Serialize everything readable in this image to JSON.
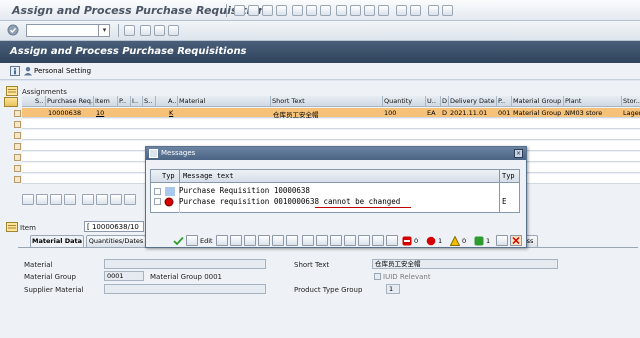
{
  "window": {
    "title": "Assign and Process Purchase Requisitions"
  },
  "toolbar": {
    "command_value": ""
  },
  "header": {
    "title": "Assign and Process Purchase Requisitions"
  },
  "app_toolbar": {
    "personal_setting": "Personal Setting"
  },
  "assignments": {
    "label": "Assignments",
    "columns": [
      "S..",
      "Purchase Req.",
      "Item",
      "P..",
      "I..",
      "S..",
      "A..",
      "Material",
      "Short Text",
      "Quantity",
      "U..",
      "D",
      "Delivery Date",
      "P..",
      "Material Group",
      "Plant",
      "Stor.."
    ],
    "row": {
      "purchase_req": "10000638",
      "item": "10",
      "acct": "K",
      "short_text": "仓库员工安全帽",
      "quantity": "100",
      "unit": "EA",
      "d": "D",
      "delivery_date": "2021.11.01",
      "p": "001",
      "material_group": "Material Group ...",
      "plant": "NM03 store",
      "stor": "Lager"
    }
  },
  "item_bar": {
    "label": "Item",
    "value": "[ 10000638/10"
  },
  "tabs": [
    "Material Data",
    "Quantities/Dates",
    "ss"
  ],
  "material_form": {
    "material_label": "Material",
    "material_group_label": "Material Group",
    "material_group_value": "0001",
    "material_group_desc": "Material Group 0001",
    "supplier_material_label": "Supplier Material",
    "short_text_label": "Short Text",
    "short_text_value": "仓库员工安全帽",
    "iuid_label": "IUID Relevant",
    "product_type_label": "Product Type Group",
    "product_type_value": "1"
  },
  "popup": {
    "title": "Messages",
    "col_typ": "Typ",
    "col_message": "Message text",
    "col_typ2": "Typ",
    "messages": [
      {
        "text": "Purchase Requisition 10000638",
        "typ": ""
      },
      {
        "text": "Purchase requisition 0010000638 cannot be changed",
        "typ": "E"
      }
    ],
    "edit_label": "Edit",
    "counts": {
      "red": "0",
      "red2": "1",
      "yellow": "0",
      "green": "1"
    },
    "colors": {
      "error": "#d40000",
      "warning": "#f0c000",
      "ok": "#2e9b2e",
      "underline": "#c00000"
    }
  }
}
